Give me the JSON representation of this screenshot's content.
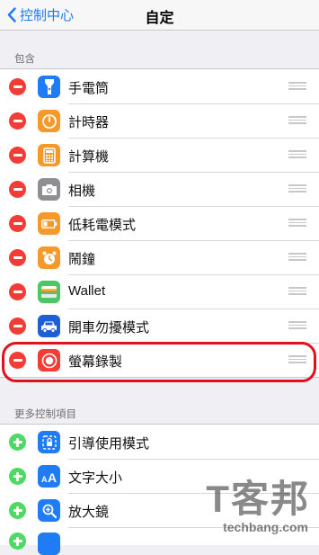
{
  "nav": {
    "back_label": "控制中心",
    "title": "自定"
  },
  "included": {
    "header": "包含",
    "items": [
      {
        "label": "手電筒",
        "icon": "flashlight-icon",
        "color": "#1f7cf5"
      },
      {
        "label": "計時器",
        "icon": "timer-icon",
        "color": "#f59a2a"
      },
      {
        "label": "計算機",
        "icon": "calculator-icon",
        "color": "#f59a2a"
      },
      {
        "label": "相機",
        "icon": "camera-icon",
        "color": "#8e8e93"
      },
      {
        "label": "低耗電模式",
        "icon": "battery-icon",
        "color": "#f59a2a"
      },
      {
        "label": "鬧鐘",
        "icon": "alarm-icon",
        "color": "#f59a2a"
      },
      {
        "label": "Wallet",
        "icon": "wallet-icon",
        "color": "#4cc764"
      },
      {
        "label": "開車勿擾模式",
        "icon": "car-icon",
        "color": "#1f5fd6"
      },
      {
        "label": "螢幕錄製",
        "icon": "screen-record-icon",
        "color": "#f43c36"
      }
    ]
  },
  "more": {
    "header": "更多控制項目",
    "items": [
      {
        "label": "引導使用模式",
        "icon": "guided-access-icon",
        "color": "#1f7cf5"
      },
      {
        "label": "文字大小",
        "icon": "text-size-icon",
        "color": "#1f7cf5"
      },
      {
        "label": "放大鏡",
        "icon": "magnifier-icon",
        "color": "#1f7cf5"
      }
    ]
  },
  "watermark": {
    "logo": "T客邦",
    "url": "techbang.com"
  }
}
